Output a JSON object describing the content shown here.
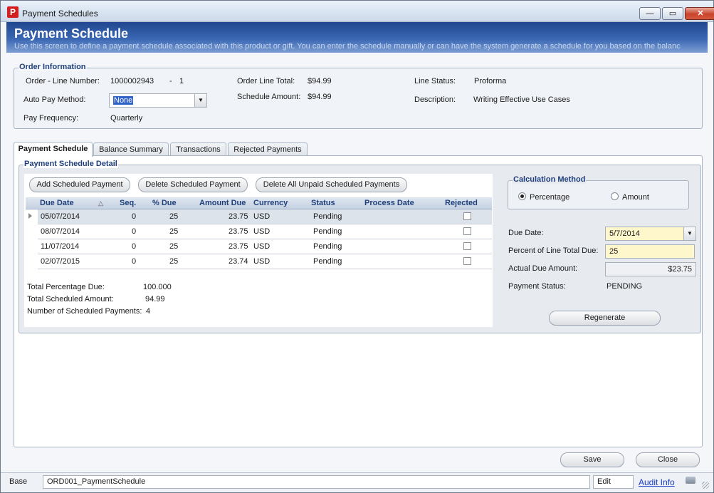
{
  "window": {
    "title": "Payment Schedules",
    "min": "—",
    "max": "▭",
    "close": "✕"
  },
  "banner": {
    "title": "Payment Schedule",
    "subtitle": "Use this screen to define a payment schedule associated with this product or gift. You can enter the schedule manually or can have the system generate a schedule for you based on the balanc"
  },
  "order_info": {
    "title": "Order Information",
    "order_line_label": "Order - Line Number:",
    "order_number": "1000002943",
    "dash": "-",
    "line_number": "1",
    "auto_pay_label": "Auto Pay Method:",
    "auto_pay_value": "None",
    "pay_freq_label": "Pay Frequency:",
    "pay_freq_value": "Quarterly",
    "line_total_label": "Order Line Total:",
    "line_total_value": "$94.99",
    "schedule_amount_label": "Schedule Amount:",
    "schedule_amount_value": "$94.99",
    "line_status_label": "Line Status:",
    "line_status_value": "Proforma",
    "description_label": "Description:",
    "description_value": "Writing Effective Use Cases"
  },
  "tabs": [
    "Payment Schedule",
    "Balance Summary",
    "Transactions",
    "Rejected Payments"
  ],
  "detail": {
    "title": "Payment Schedule Detail",
    "add_btn": "Add Scheduled Payment",
    "delete_btn": "Delete Scheduled Payment",
    "delete_all_btn": "Delete All Unpaid Scheduled Payments",
    "columns": [
      "Due Date",
      "Seq.",
      "% Due",
      "Amount Due",
      "Currency",
      "Status",
      "Process Date",
      "Rejected"
    ],
    "sort_icon": "△",
    "rows": [
      {
        "date": "05/07/2014",
        "seq": "0",
        "pct": "25",
        "amount": "23.75",
        "currency": "USD",
        "status": "Pending"
      },
      {
        "date": "08/07/2014",
        "seq": "0",
        "pct": "25",
        "amount": "23.75",
        "currency": "USD",
        "status": "Pending"
      },
      {
        "date": "11/07/2014",
        "seq": "0",
        "pct": "25",
        "amount": "23.75",
        "currency": "USD",
        "status": "Pending"
      },
      {
        "date": "02/07/2015",
        "seq": "0",
        "pct": "25",
        "amount": "23.74",
        "currency": "USD",
        "status": "Pending"
      }
    ],
    "total_pct_label": "Total Percentage Due:",
    "total_pct_value": "100.000",
    "total_amount_label": "Total Scheduled Amount:",
    "total_amount_value": "94.99",
    "num_payments_label": "Number of Scheduled Payments:",
    "num_payments_value": "4"
  },
  "calc": {
    "title": "Calculation Method",
    "percentage": "Percentage",
    "amount": "Amount",
    "due_date_label": "Due Date:",
    "due_date_value": "5/7/2014",
    "percent_label": "Percent of Line Total Due:",
    "percent_value": "25",
    "actual_label": "Actual Due Amount:",
    "actual_value": "$23.75",
    "status_label": "Payment Status:",
    "status_value": "PENDING",
    "regenerate": "Regenerate"
  },
  "footer": {
    "save": "Save",
    "close": "Close"
  },
  "statusbar": {
    "base": "Base",
    "form": "ORD001_PaymentSchedule",
    "mode": "Edit",
    "audit": "Audit Info"
  },
  "colors": {
    "accent": "#1f3f7a",
    "banner": "#2a54a0",
    "link": "#1a3cc8",
    "highlight": "#fff7cc"
  }
}
